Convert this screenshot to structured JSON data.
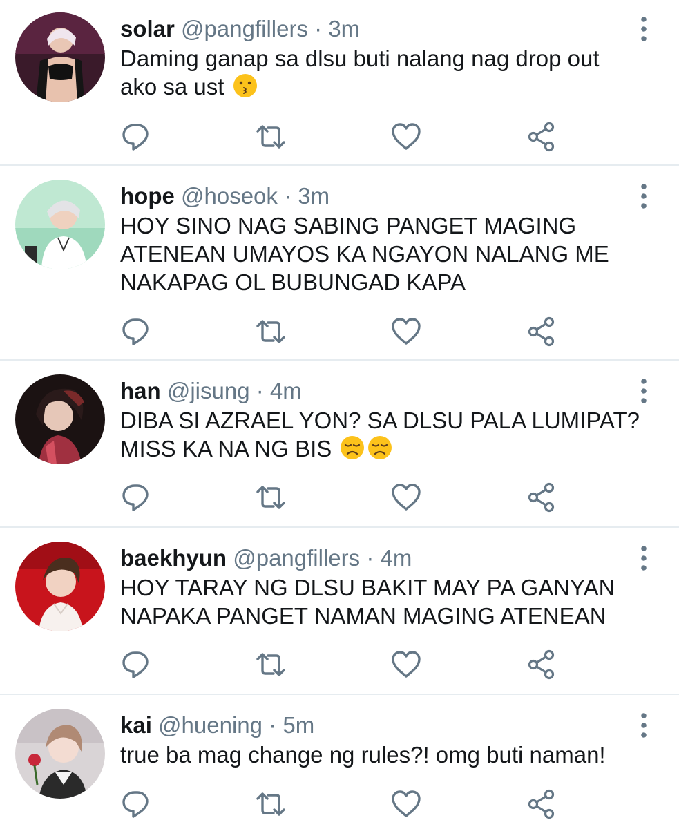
{
  "tweets": [
    {
      "name": "solar",
      "handle": "@pangfillers",
      "separator": "·",
      "time": "3m",
      "lines": [
        "Daming ganap sa dlsu buti nalang nag drop out",
        "ako sa ust"
      ],
      "emoji": [
        "kissing-face-emoji"
      ]
    },
    {
      "name": "hope",
      "handle": "@hoseok",
      "separator": "·",
      "time": "3m",
      "lines": [
        "HOY SINO NAG SABING PANGET MAGING",
        "ATENEAN UMAYOS KA NGAYON NALANG ME",
        "NAKAPAG OL BUBUNGAD KAPA"
      ],
      "emoji": []
    },
    {
      "name": "han",
      "handle": "@jisung",
      "separator": "·",
      "time": "4m",
      "lines": [
        "DIBA SI AZRAEL YON? SA DLSU PALA LUMIPAT?",
        "MISS KA NA NG BIS"
      ],
      "emoji": [
        "disappointed-face-emoji",
        "disappointed-face-emoji"
      ]
    },
    {
      "name": "baekhyun",
      "handle": "@pangfillers",
      "separator": "·",
      "time": "4m",
      "lines": [
        "HOY TARAY NG DLSU BAKIT MAY PA GANYAN",
        "NAPAKA PANGET NAMAN MAGING ATENEAN"
      ],
      "emoji": []
    },
    {
      "name": "kai",
      "handle": "@huening",
      "separator": "·",
      "time": "5m",
      "lines": [
        "true ba mag change ng rules?! omg buti naman!"
      ],
      "emoji": []
    }
  ],
  "actions": [
    "reply-icon",
    "retweet-icon",
    "like-icon",
    "share-icon"
  ],
  "colors": {
    "name": "#14171a",
    "muted": "#657786",
    "divider": "#e6ecf0",
    "icon": "#657786"
  }
}
